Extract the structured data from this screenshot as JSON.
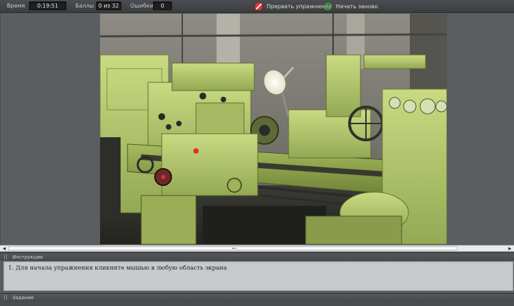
{
  "topbar": {
    "time_label": "Время",
    "time_value": "0:19:51",
    "score_label": "Баллы",
    "score_value": "0 из 32",
    "errors_label": "Ошибки",
    "errors_value": "0",
    "abort_label": "Прервать упражнение",
    "restart_label": "Начать заново"
  },
  "instructions": {
    "title": "Инструкции",
    "text": "1. Для начала упражнения кликните мышью в любую область экрана"
  },
  "task": {
    "title": "Задание"
  },
  "colors": {
    "machine_green": "#b7cc6a",
    "abort_red": "#d83a3a",
    "restart_green": "#3fae3a"
  },
  "icons": {
    "abort": "no-entry-icon",
    "restart": "refresh-icon"
  }
}
